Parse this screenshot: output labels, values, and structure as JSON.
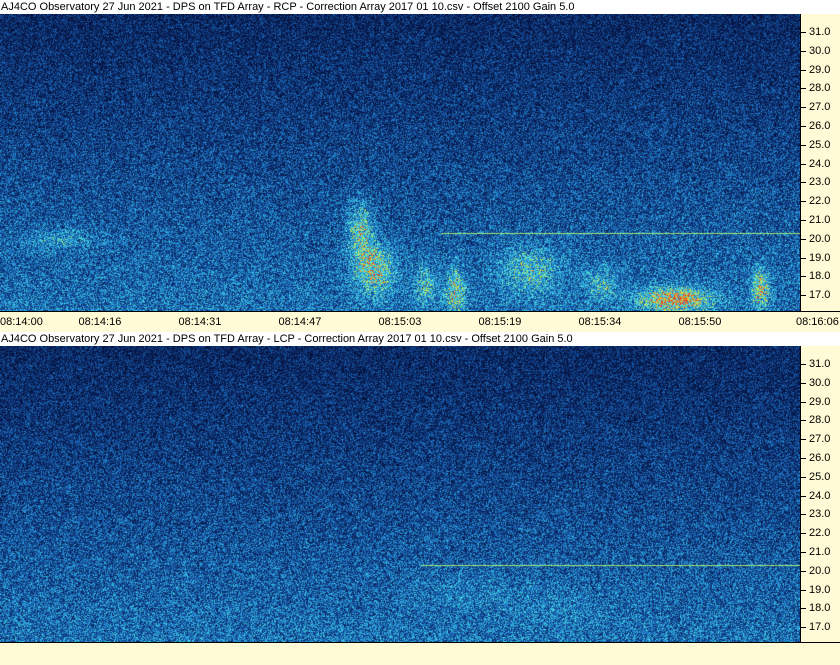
{
  "panels": [
    {
      "id": "rcp",
      "title": "AJ4CO Observatory 27 Jun 2021  -  DPS on TFD Array  -  RCP  -  Correction Array 2017 01 10.csv  -  Offset 2100  Gain 5.0"
    },
    {
      "id": "lcp",
      "title": "AJ4CO Observatory 27 Jun 2021  -  DPS on TFD Array  -  LCP  -  Correction Array 2017 01 10.csv  -  Offset 2100  Gain 5.0"
    }
  ],
  "frequency_labels": [
    "31.0",
    "30.0",
    "29.0",
    "28.0",
    "27.0",
    "26.0",
    "25.0",
    "24.0",
    "23.0",
    "22.0",
    "21.0",
    "20.0",
    "19.0",
    "18.0",
    "17.0"
  ],
  "time_labels": [
    "08:14:00",
    "08:14:16",
    "08:14:31",
    "08:14:47",
    "08:15:03",
    "08:15:19",
    "08:15:34",
    "08:15:50",
    "08:16:06"
  ],
  "colors": {
    "axis_background": "#FFFBD6",
    "spectrogram_low": "#0B2A5A",
    "spectrogram_mid": "#1E7FC8",
    "spectrogram_high": "#36D1E8",
    "burst_yellow": "#E8E040",
    "burst_red": "#E04020"
  }
}
